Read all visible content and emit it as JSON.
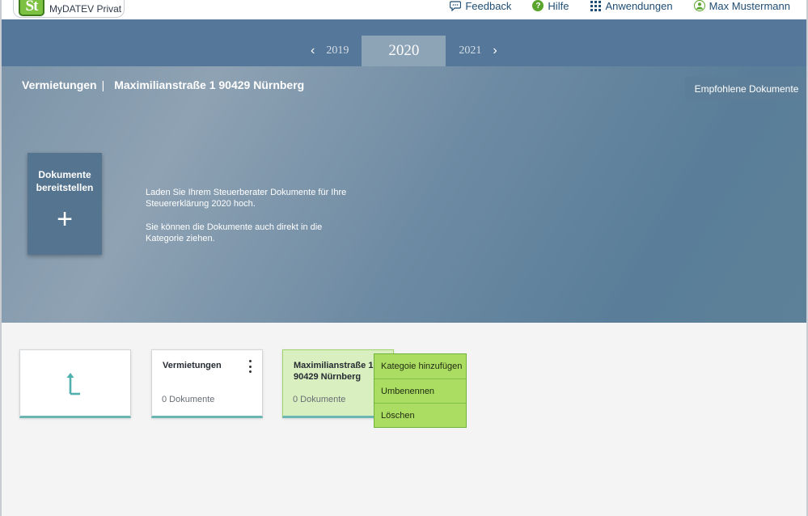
{
  "app": {
    "logo_glyph": "St",
    "name": "MyDATEV Privat"
  },
  "nav": [
    {
      "icon": "feedback-icon",
      "label": "Feedback"
    },
    {
      "icon": "help-icon",
      "label": "Hilfe"
    },
    {
      "icon": "apps-grid-icon",
      "label": "Anwendungen"
    },
    {
      "icon": "user-icon",
      "label": "Max Mustermann"
    }
  ],
  "years": {
    "prev": "2019",
    "current": "2020",
    "next": "2021"
  },
  "breadcrumb": {
    "section": "Vermietungen",
    "separator": "|",
    "property": "Maximilianstraße 1 90429 Nürnberg"
  },
  "recommended_button": "Empfohlene Dokumente",
  "upload": {
    "title": "Dokumente bereitstellen",
    "plus": "+"
  },
  "info": {
    "line1": "Laden Sie Ihrem Steuerberater Dokumente für Ihre Steuererklärung 2020 hoch.",
    "line2": "Sie können die Dokumente auch direkt in die Kategorie ziehen."
  },
  "cards": [
    {
      "title": "Vermietungen",
      "count": "0 Dokumente"
    },
    {
      "title": "Maximilianstraße 1 90429 Nürnberg",
      "count": "0 Dokumente"
    }
  ],
  "context_menu": [
    {
      "label": "Kategoie hinzufügen"
    },
    {
      "label": "Umbenennen"
    },
    {
      "label": "Löschen"
    }
  ],
  "colors": {
    "accent_green": "#7cc142",
    "header_blue": "#55779a",
    "card_underline": "#6bb5b3"
  }
}
